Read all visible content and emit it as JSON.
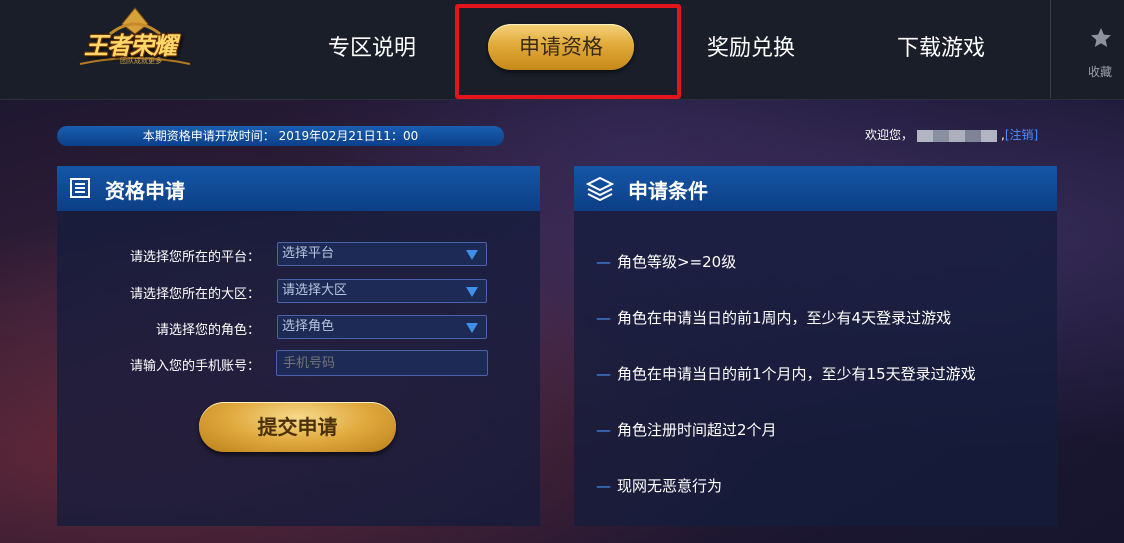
{
  "header": {
    "logo_text": "王者荣耀",
    "logo_sub": "团队成就更多",
    "nav": [
      {
        "label": "专区说明"
      },
      {
        "label": "申请资格"
      },
      {
        "label": "奖励兑换"
      },
      {
        "label": "下载游戏"
      }
    ],
    "favorite_label": "收藏",
    "highlight_color": "#e3141c"
  },
  "notice": {
    "open_time": "本期资格申请开放时间： 2019年02月21日11：00"
  },
  "user": {
    "welcome": "欢迎您，",
    "logout": "[注销]"
  },
  "apply_panel": {
    "title": "资格申请",
    "fields": [
      {
        "label": "请选择您所在的平台：",
        "value": "选择平台",
        "type": "select"
      },
      {
        "label": "请选择您所在的大区：",
        "value": "请选择大区",
        "type": "select"
      },
      {
        "label": "请选择您的角色：",
        "value": "选择角色",
        "type": "select"
      },
      {
        "label": "请输入您的手机账号：",
        "placeholder": "手机号码",
        "type": "input"
      }
    ],
    "submit_label": "提交申请"
  },
  "conditions_panel": {
    "title": "申请条件",
    "items": [
      "角色等级>=20级",
      "角色在申请当日的前1周内，至少有4天登录过游戏",
      "角色在申请当日的前1个月内，至少有15天登录过游戏",
      "角色注册时间超过2个月",
      "现网无恶意行为"
    ],
    "dash": "—"
  },
  "colors": {
    "panel_header": "#1456a6",
    "gold": "#e1aa3a",
    "link": "#4e8cff"
  }
}
